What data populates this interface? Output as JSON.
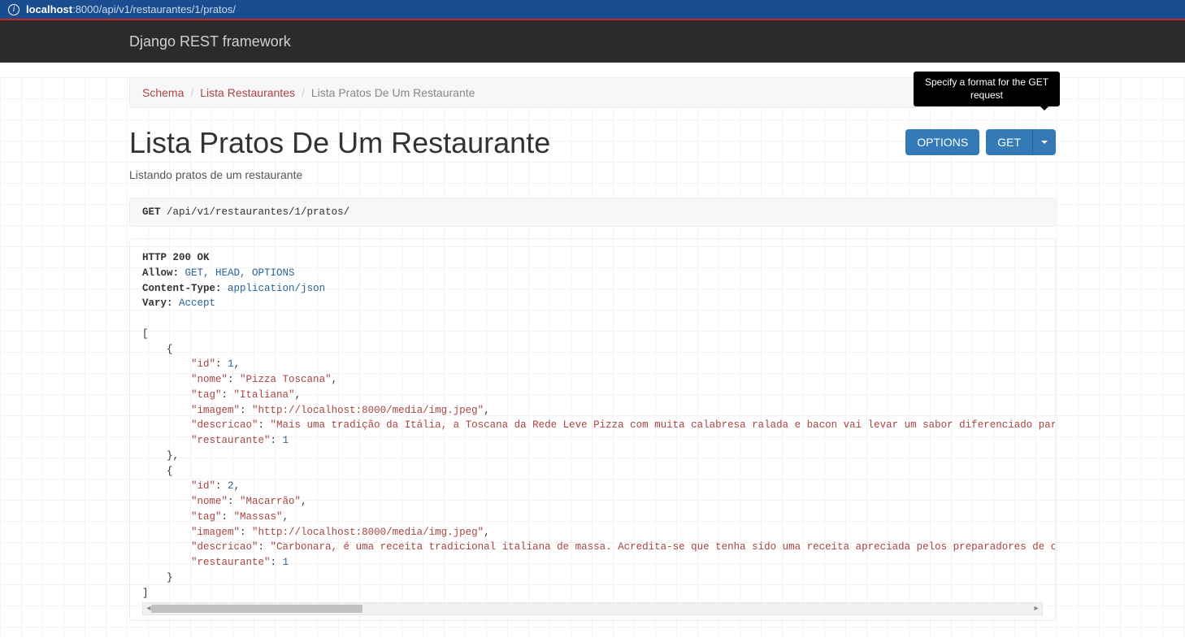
{
  "url": {
    "host": "localhost",
    "port": "8000",
    "path": "/api/v1/restaurantes/1/pratos/"
  },
  "navbar": {
    "brand": "Django REST framework"
  },
  "breadcrumb": {
    "items": [
      {
        "label": "Schema",
        "link": true
      },
      {
        "label": "Lista Restaurantes",
        "link": true
      },
      {
        "label": "Lista Pratos De Um Restaurante",
        "link": false
      }
    ]
  },
  "tooltip": "Specify a format for the GET request",
  "page": {
    "title": "Lista Pratos De Um Restaurante",
    "description": "Listando pratos de um restaurante"
  },
  "buttons": {
    "options": "OPTIONS",
    "get": "GET"
  },
  "request": {
    "method": "GET",
    "path": "/api/v1/restaurantes/1/pratos/"
  },
  "response": {
    "status_line": "HTTP 200 OK",
    "headers": [
      {
        "k": "Allow",
        "v": "GET, HEAD, OPTIONS"
      },
      {
        "k": "Content-Type",
        "v": "application/json"
      },
      {
        "k": "Vary",
        "v": "Accept"
      }
    ],
    "body": [
      {
        "id": 1,
        "nome": "Pizza Toscana",
        "tag": "Italiana",
        "imagem": "http://localhost:8000/media/img.jpeg",
        "descricao": "Mais uma tradição da Itália, a Toscana da Rede Leve Pizza com muita calabresa ralada e bacon vai levar um sabor diferenciado para sua mesa.",
        "restaurante": 1
      },
      {
        "id": 2,
        "nome": "Macarrão",
        "tag": "Massas",
        "imagem": "http://localhost:8000/media/img.jpeg",
        "descricao": "Carbonara, é uma receita tradicional italiana de massa. Acredita-se que tenha sido uma receita apreciada pelos preparadores de carvão vegetal (carbina",
        "restaurante": 1
      }
    ]
  }
}
